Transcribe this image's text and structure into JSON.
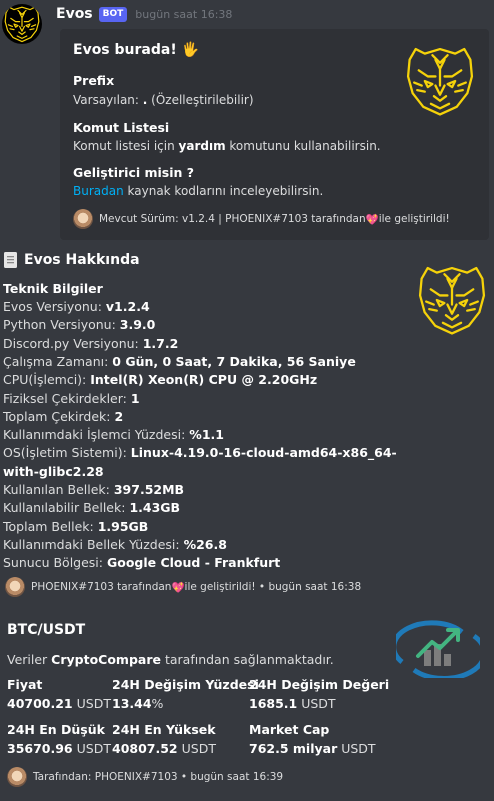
{
  "message": {
    "username": "Evos",
    "bot_tag": "BOT",
    "timestamp": "bugün saat 16:38"
  },
  "embed1": {
    "title": "Evos burada! 🖐",
    "prefix_name": "Prefix",
    "prefix_text_a": "Varsayılan: ",
    "prefix_value": ".",
    "prefix_text_b": " (Özelleştirilebilir)",
    "commands_name": "Komut Listesi",
    "commands_text_a": "Komut listesi için ",
    "commands_bold": "yardım",
    "commands_text_b": " komutunu kullanabilirsin.",
    "dev_name": "Geliştirici misin ?",
    "dev_link": "Buradan",
    "dev_text": " kaynak kodlarını inceleyebilirsin.",
    "footer_a": "Mevcut Sürüm: v1.2.4 | PHOENIX#7103 tarafından ",
    "footer_heart": "💖",
    "footer_b": " ile geliştirildi!"
  },
  "about": {
    "icon": "page-icon",
    "title": "Evos Hakkında",
    "section": "Teknik Bilgiler",
    "rows": [
      {
        "label": "Evos Versiyonu: ",
        "value": "v1.2.4"
      },
      {
        "label": "Python Versiyonu: ",
        "value": "3.9.0"
      },
      {
        "label": "Discord.py Versiyonu: ",
        "value": "1.7.2"
      },
      {
        "label": "Çalışma Zamanı: ",
        "value": "0 Gün, 0 Saat, 7 Dakika, 56 Saniye"
      },
      {
        "label": "CPU(İşlemci): ",
        "value": "Intel(R) Xeon(R) CPU @ 2.20GHz"
      },
      {
        "label": "Fiziksel Çekirdekler: ",
        "value": "1"
      },
      {
        "label": "Toplam Çekirdek: ",
        "value": "2"
      },
      {
        "label": "Kullanımdaki İşlemci Yüzdesi: ",
        "value": "%1.1"
      },
      {
        "label": "OS(İşletim Sistemi): ",
        "value": "Linux-4.19.0-16-cloud-amd64-x86_64-"
      },
      {
        "label": "",
        "value": "with-glibc2.28"
      },
      {
        "label": "Kullanılan Bellek: ",
        "value": "397.52MB"
      },
      {
        "label": "Kullanılabilir Bellek: ",
        "value": "1.43GB"
      },
      {
        "label": "Toplam Bellek: ",
        "value": "1.95GB"
      },
      {
        "label": "Kullanımdaki Bellek Yüzdesi: ",
        "value": "%26.8"
      },
      {
        "label": "Sunucu Bölgesi: ",
        "value": "Google Cloud - Frankfurt"
      }
    ],
    "footer_a": "PHOENIX#7103 tarafından ",
    "footer_heart": "💖",
    "footer_b": " ile geliştirildi! • bugün saat 16:38"
  },
  "btc": {
    "title": "BTC/USDT",
    "desc_a": "Veriler ",
    "desc_bold": "CryptoCompare",
    "desc_b": " tarafından sağlanmaktadır.",
    "fields": [
      {
        "name": "Fiyat",
        "value": "40700.21",
        "unit": " USDT"
      },
      {
        "name": "24H Değişim Yüzdesi",
        "value": "13.44",
        "unit": "%"
      },
      {
        "name": "24H Değişim Değeri",
        "value": "1685.1",
        "unit": " USDT"
      },
      {
        "name": "24H En Düşük",
        "value": "35670.96",
        "unit": " USDT"
      },
      {
        "name": "24H En Yüksek",
        "value": "40807.52",
        "unit": " USDT"
      },
      {
        "name": "Market Cap",
        "value": "762.5 milyar",
        "unit": " USDT"
      }
    ],
    "footer": "Tarafından: PHOENIX#7103 • bugün saat 16:39"
  },
  "colors": {
    "background": "#36393f",
    "embed_bg": "#2f3136",
    "bot_tag": "#5865f2",
    "link": "#00aff4",
    "tiger": "#f5d20a"
  }
}
